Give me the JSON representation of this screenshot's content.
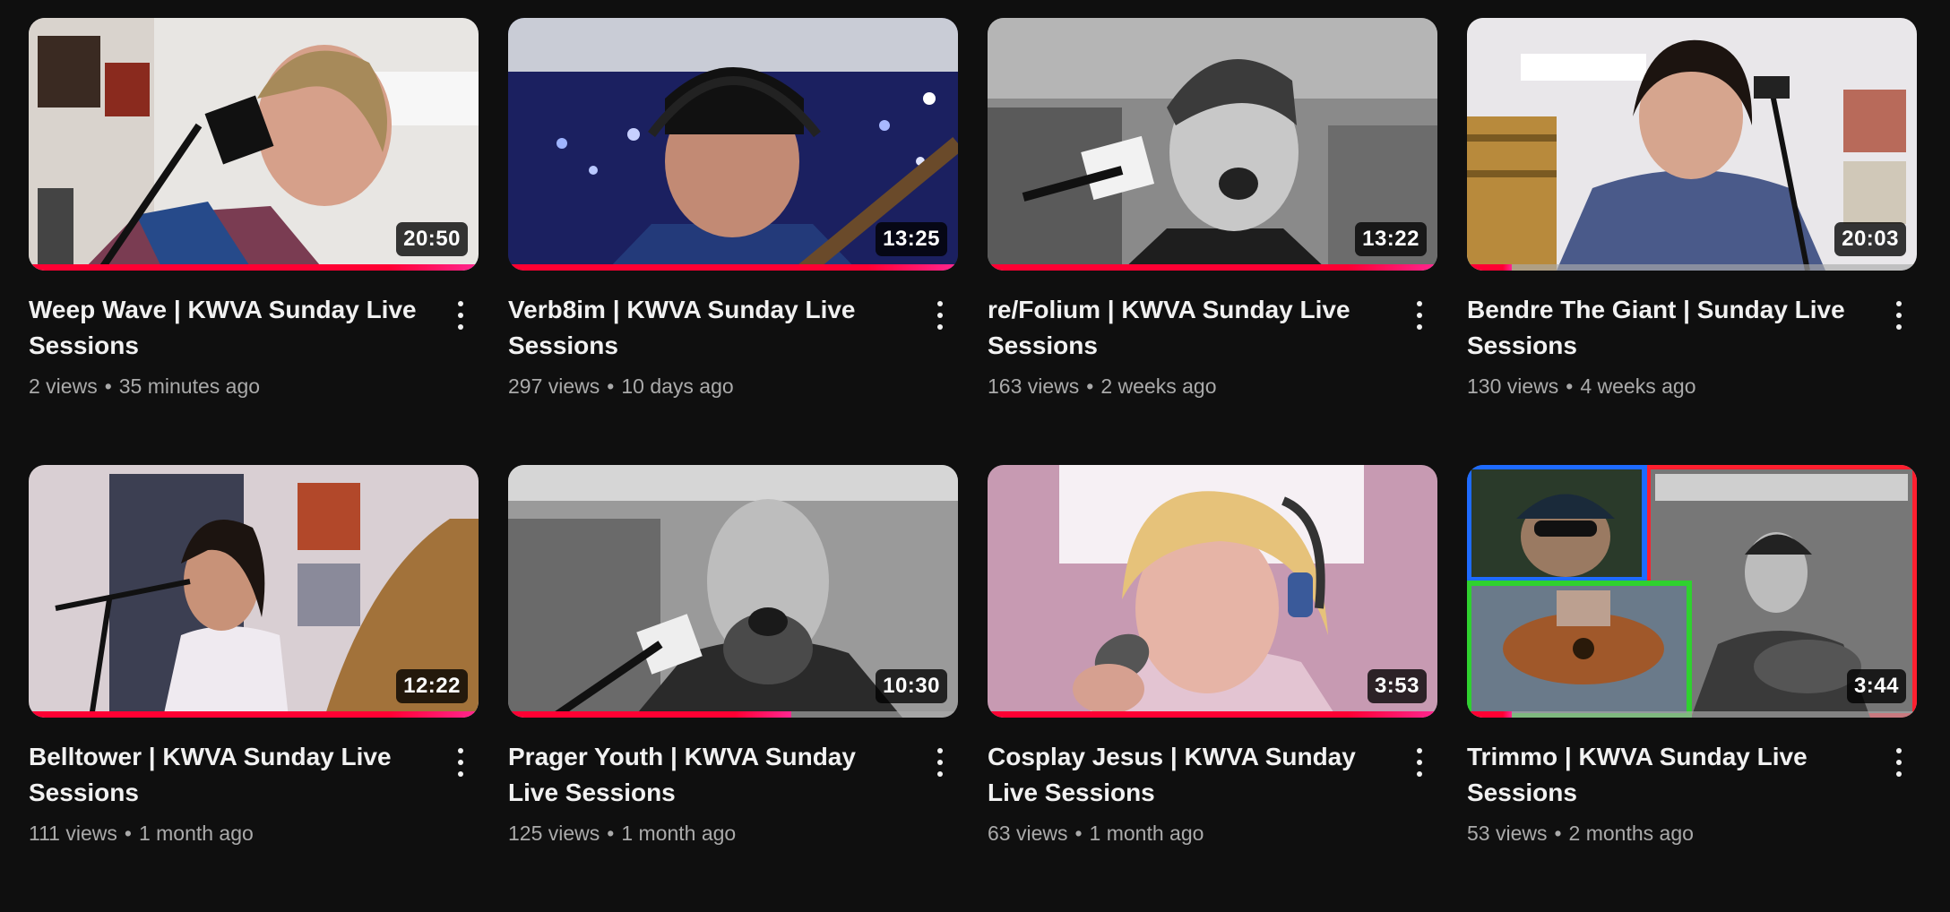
{
  "videos": [
    {
      "title": "Weep Wave | KWVA Sunday Live Sessions",
      "views": "2 views",
      "age": "35 minutes ago",
      "duration": "20:50",
      "progress": 1.0
    },
    {
      "title": "Verb8im | KWVA Sunday Live Sessions",
      "views": "297 views",
      "age": "10 days ago",
      "duration": "13:25",
      "progress": 1.0
    },
    {
      "title": "re/Folium | KWVA Sunday Live Sessions",
      "views": "163 views",
      "age": "2 weeks ago",
      "duration": "13:22",
      "progress": 1.0
    },
    {
      "title": "Bendre The Giant | Sunday Live Sessions",
      "views": "130 views",
      "age": "4 weeks ago",
      "duration": "20:03",
      "progress": 0.1
    },
    {
      "title": "Belltower | KWVA Sunday Live Sessions",
      "views": "111 views",
      "age": "1 month ago",
      "duration": "12:22",
      "progress": 1.0
    },
    {
      "title": "Prager Youth | KWVA Sunday Live Sessions",
      "views": "125 views",
      "age": "1 month ago",
      "duration": "10:30",
      "progress": 0.63
    },
    {
      "title": "Cosplay Jesus | KWVA Sunday Live Sessions",
      "views": "63 views",
      "age": "1 month ago",
      "duration": "3:53",
      "progress": 1.0
    },
    {
      "title": "Trimmo | KWVA Sunday Live Sessions",
      "views": "53 views",
      "age": "2 months ago",
      "duration": "3:44",
      "progress": 0.1
    }
  ],
  "separator": "•",
  "icons": {
    "menu": "more-vert-icon"
  },
  "colors": {
    "background": "#0f0f0f",
    "progress": "#ff0033",
    "meta_text": "#aaaaaa"
  }
}
